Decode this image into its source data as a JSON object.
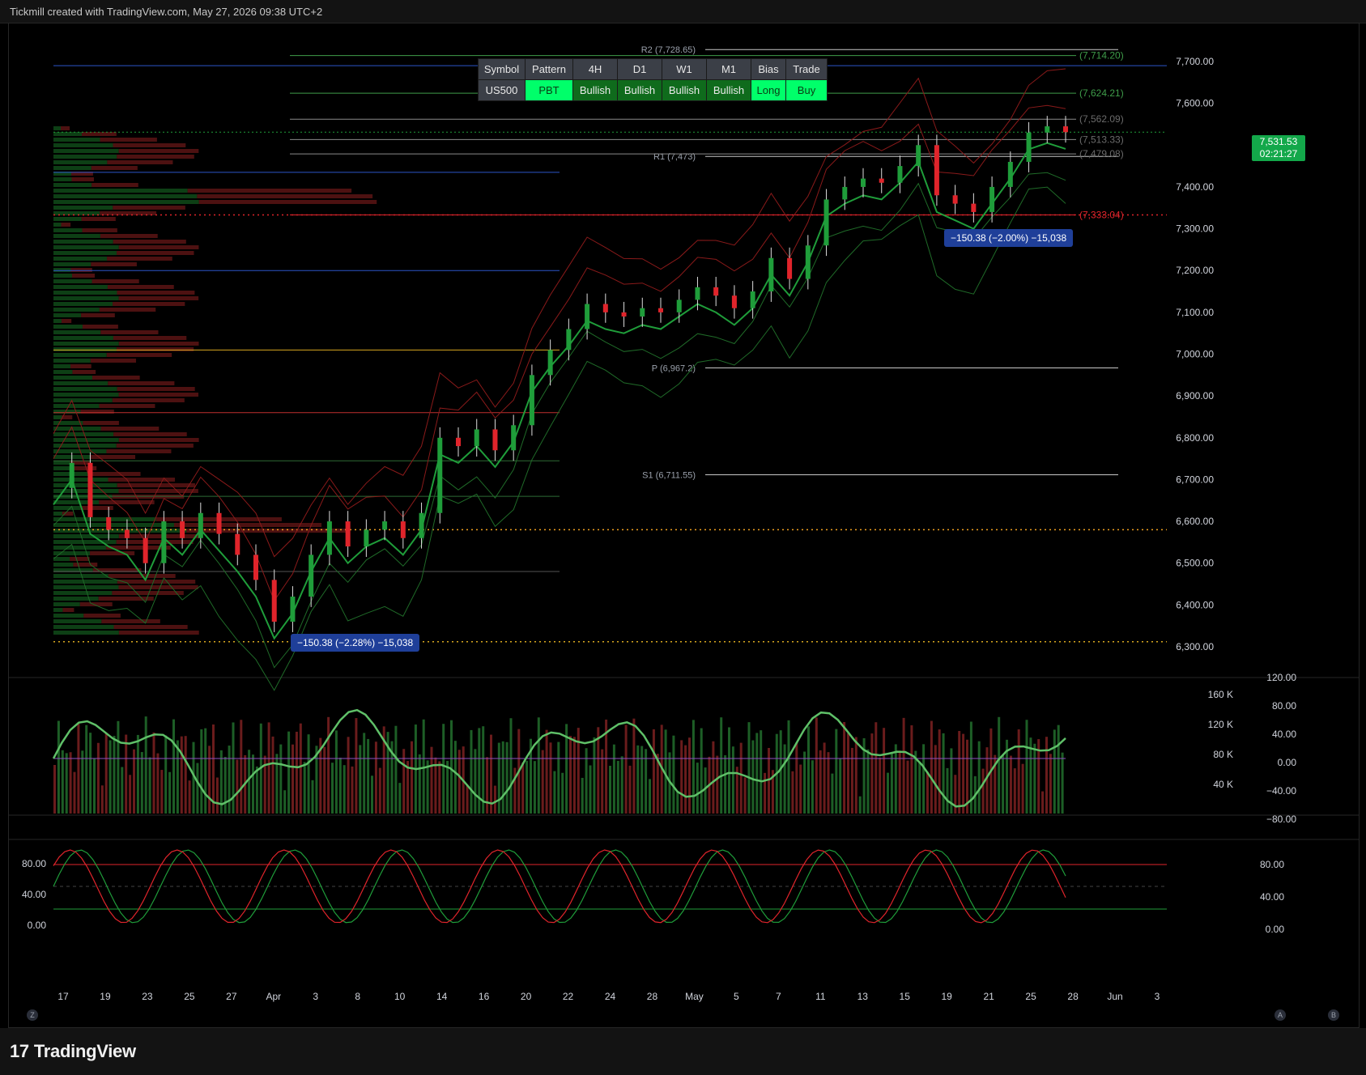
{
  "header": {
    "title": "Tickmill created with TradingView.com, May 27, 2026 09:38 UTC+2"
  },
  "footer": {
    "logo_text": "TradingView",
    "logo_mark": "17"
  },
  "colors": {
    "up": "#1f9d3a",
    "down": "#e0242b",
    "bull_cell": "#0f6b1c",
    "bright_cell": "#00ff6a",
    "axis_bg": "#000000"
  },
  "table": {
    "headers": [
      "Symbol",
      "Pattern",
      "4H",
      "D1",
      "W1",
      "M1",
      "Bias",
      "Trade"
    ],
    "values": [
      "US500",
      "PBT",
      "Bullish",
      "Bullish",
      "Bullish",
      "Bullish",
      "Long",
      "Buy"
    ]
  },
  "last_price": {
    "price": "7,531.53",
    "countdown": "02:21:27"
  },
  "buttons": {
    "z": "Z",
    "a": "A",
    "b": "B"
  },
  "chart_data": [
    {
      "type": "line",
      "name": "price",
      "y_ticks": [
        6300,
        6400,
        6500,
        6600,
        6700,
        6800,
        6900,
        7000,
        7100,
        7200,
        7300,
        7400,
        7500,
        7600,
        7700
      ],
      "y_tick_labels": [
        "6,300.00",
        "6,400.00",
        "6,500.00",
        "6,600.00",
        "6,700.00",
        "6,800.00",
        "6,900.00",
        "7,000.00",
        "7,100.00",
        "7,200.00",
        "7,300.00",
        "7,400.00",
        "",
        "7,600.00",
        "7,700.00"
      ],
      "ylim": [
        6230,
        7770
      ],
      "x_ticks": [
        "17",
        "19",
        "23",
        "25",
        "27",
        "Apr",
        "3",
        "8",
        "10",
        "14",
        "16",
        "20",
        "22",
        "24",
        "28",
        "May",
        "5",
        "7",
        "11",
        "13",
        "15",
        "19",
        "21",
        "25",
        "28",
        "Jun",
        "3"
      ],
      "close_path": [
        6680,
        6740,
        6610,
        6580,
        6560,
        6500,
        6600,
        6560,
        6620,
        6570,
        6520,
        6460,
        6360,
        6420,
        6520,
        6600,
        6540,
        6580,
        6600,
        6560,
        6620,
        6800,
        6780,
        6820,
        6770,
        6830,
        6950,
        7010,
        7060,
        7120,
        7100,
        7090,
        7110,
        7100,
        7130,
        7160,
        7140,
        7110,
        7150,
        7230,
        7180,
        7260,
        7370,
        7400,
        7420,
        7410,
        7450,
        7500,
        7380,
        7360,
        7340,
        7400,
        7460,
        7530,
        7545,
        7531
      ],
      "levels": [
        {
          "label": "R2 (7,728.65)",
          "value": 7728.65
        },
        {
          "label": "R1 (7,473)",
          "value": 7473
        },
        {
          "label": "P (6,967.2)",
          "value": 6967.2
        },
        {
          "label": "S1 (6,711.55)",
          "value": 6711.55
        }
      ],
      "right_labels": [
        {
          "label": "(7,714.20)",
          "value": 7714.2,
          "color": "#3f9d4a"
        },
        {
          "label": "(7,624.21)",
          "value": 7624.21,
          "color": "#3f9d4a"
        },
        {
          "label": "(7,562.09)",
          "value": 7562.09,
          "color": "#6b6b6b"
        },
        {
          "label": "(7,513.33)",
          "value": 7513.33,
          "color": "#6b6b6b"
        },
        {
          "label": "(7,479.08)",
          "value": 7479.08,
          "color": "#6b6b6b"
        },
        {
          "label": "(7,333.04)",
          "value": 7333.04,
          "color": "#e0242b"
        }
      ],
      "annotations": [
        "−150.38 (−2.28%) −15,038",
        "−150.38 (−2.00%) −15,038"
      ]
    },
    {
      "type": "bar",
      "name": "volume",
      "right_ticks": [
        "160 K",
        "120 K",
        "80 K",
        "40 K"
      ],
      "osc_ticks": [
        "120.00",
        "80.00",
        "40.00",
        "0.00",
        "−40.00",
        "−80.00"
      ]
    },
    {
      "type": "line",
      "name": "stochastic",
      "left_ticks": [
        "80.00",
        "40.00",
        "0.00"
      ],
      "right_ticks": [
        "80.00",
        "40.00",
        "0.00"
      ]
    }
  ]
}
